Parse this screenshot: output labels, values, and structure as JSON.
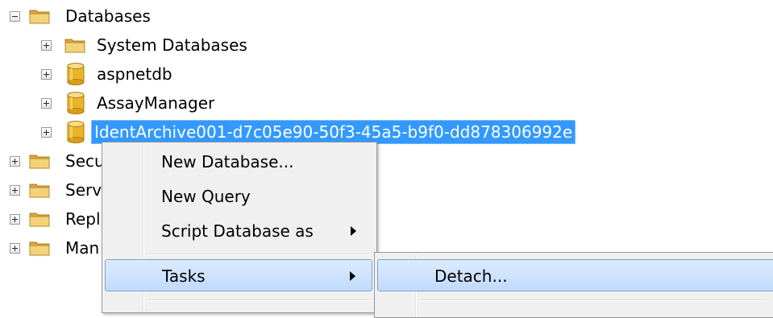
{
  "tree": {
    "databases_label": "Databases",
    "children": [
      {
        "label": "System Databases",
        "icon": "folder-icon"
      },
      {
        "label": "aspnetdb",
        "icon": "database-icon"
      },
      {
        "label": "AssayManager",
        "icon": "database-icon"
      },
      {
        "label": "IdentArchive001-d7c05e90-50f3-45a5-b9f0-dd878306992e",
        "icon": "database-icon",
        "selected": true
      }
    ],
    "siblings": [
      {
        "label": "Secu"
      },
      {
        "label": "Serv"
      },
      {
        "label": "Repl"
      },
      {
        "label": "Man"
      }
    ]
  },
  "context_menu": {
    "items": [
      {
        "label": "New Database..."
      },
      {
        "label": "New Query"
      },
      {
        "label": "Script Database as",
        "has_submenu": true
      },
      {
        "label": "Tasks",
        "has_submenu": true,
        "highlighted": true
      }
    ]
  },
  "submenu": {
    "items": [
      {
        "label": "Detach...",
        "highlighted": true
      }
    ]
  },
  "colors": {
    "selection": "#3399ff",
    "menu_bg": "#f0f0f0",
    "hover_bg": "#c1dbfc",
    "folder": "#e8c25c",
    "database": "#e9b42a"
  }
}
